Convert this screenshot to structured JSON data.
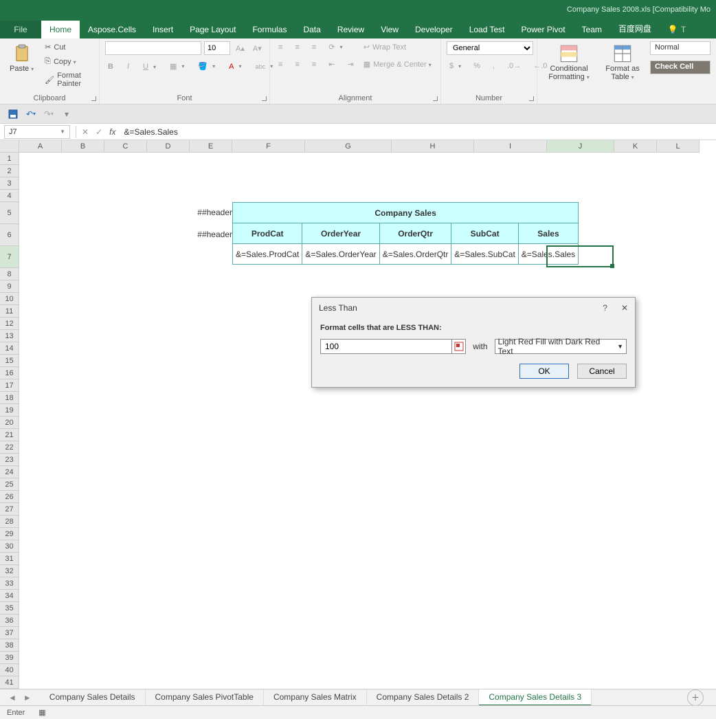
{
  "title": "Company Sales 2008.xls  [Compatibility Mo",
  "tabs": {
    "file": "File",
    "home": "Home",
    "aspose": "Aspose.Cells",
    "insert": "Insert",
    "pagelayout": "Page Layout",
    "formulas": "Formulas",
    "data": "Data",
    "review": "Review",
    "view": "View",
    "developer": "Developer",
    "loadtest": "Load Test",
    "powerpivot": "Power Pivot",
    "team": "Team",
    "baidu": "百度网盘",
    "tell": "T"
  },
  "clipboard": {
    "paste": "Paste",
    "cut": "Cut",
    "copy": "Copy",
    "painter": "Format Painter",
    "label": "Clipboard"
  },
  "font": {
    "label": "Font",
    "size": "10"
  },
  "alignment": {
    "wrap": "Wrap Text",
    "merge": "Merge & Center",
    "label": "Alignment"
  },
  "number": {
    "format": "General",
    "label": "Number"
  },
  "stylesgrp": {
    "cond": "Conditional Formatting",
    "fmt": "Format as Table",
    "normal": "Normal",
    "check": "Check Cell"
  },
  "namebox": "J7",
  "formula": "&=Sales.Sales",
  "cols": {
    "A": 62,
    "B": 62,
    "C": 62,
    "D": 62,
    "E": 62,
    "F": 106,
    "G": 126,
    "H": 120,
    "I": 106,
    "J": 98,
    "K": 62,
    "L": 62
  },
  "rows": [
    "1",
    "2",
    "3",
    "4",
    "5",
    "6",
    "7",
    "8",
    "9",
    "10",
    "11",
    "12",
    "13",
    "14",
    "15",
    "16",
    "17",
    "18",
    "19",
    "20",
    "21",
    "22",
    "23",
    "24",
    "25",
    "26",
    "27",
    "28",
    "29",
    "30",
    "31",
    "32",
    "33",
    "34",
    "35",
    "36",
    "37",
    "38",
    "39",
    "40",
    "41"
  ],
  "rowLabel5": "##header",
  "rowLabel6": "##header",
  "tableHdrTop": "Company Sales",
  "tableHdrCols": [
    "ProdCat",
    "OrderYear",
    "OrderQtr",
    "SubCat",
    "Sales"
  ],
  "tableData": [
    "&=Sales.ProdCat",
    "&=Sales.OrderYear",
    "&=Sales.OrderQtr",
    "&=Sales.SubCat",
    "&=Sales.Sales"
  ],
  "dialog": {
    "title": "Less Than",
    "label": "Format cells that are LESS THAN:",
    "value": "100",
    "with": "with",
    "select": "Light Red Fill with Dark Red Text",
    "ok": "OK",
    "cancel": "Cancel"
  },
  "sheetTabs": [
    "Company Sales Details",
    "Company Sales PivotTable",
    "Company Sales Matrix",
    "Company Sales Details 2",
    "Company Sales Details 3"
  ],
  "activeSheet": 4,
  "status": "Enter"
}
